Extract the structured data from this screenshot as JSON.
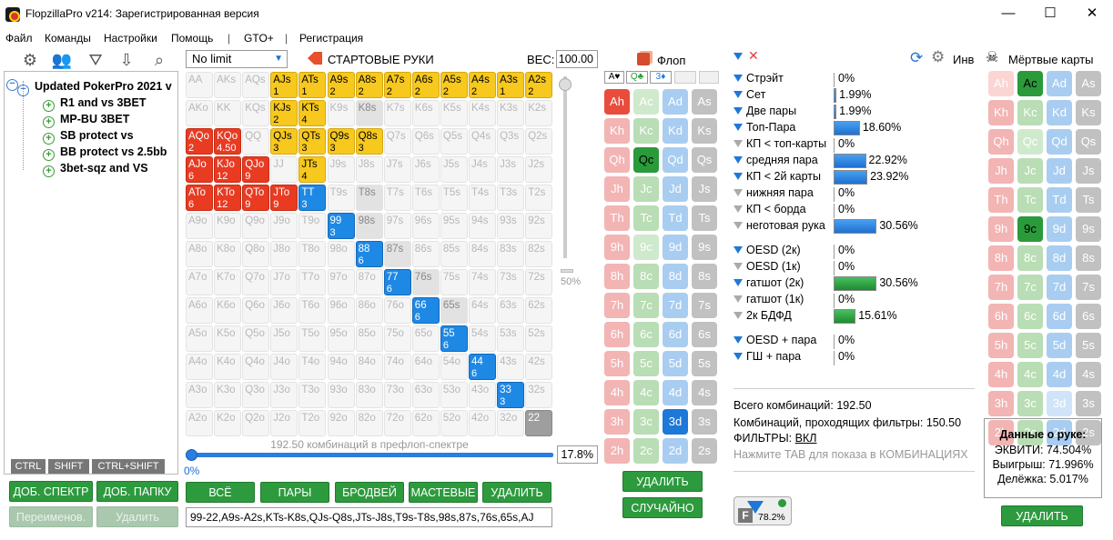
{
  "window": {
    "title": "FlopzillaPro v214: Зарегистрированная версия",
    "min": "—",
    "max": "☐",
    "close": "✕"
  },
  "menu": [
    "Файл",
    "Команды",
    "Настройки",
    "Помощь",
    "|",
    "GTO+",
    "|",
    "Регистрация"
  ],
  "tree": {
    "root": "Updated PokerPro 2021 v",
    "items": [
      "R1 and vs 3BET",
      "MP-BU 3BET",
      "SB protect vs",
      "BB protect vs 2.5bb",
      "3bet-sqz and VS"
    ]
  },
  "modkeys": [
    "CTRL",
    "SHIFT",
    "CTRL+SHIFT"
  ],
  "left_buttons": {
    "add_range": "ДОБ. СПЕКТР",
    "add_folder": "ДОБ. ПАПКУ",
    "rename": "Переименов.",
    "delete": "Удалить"
  },
  "range": {
    "limit": "No limit",
    "section": "СТАРТОВЫЕ РУКИ",
    "weight_label": "ВЕС:",
    "weight": "100.00",
    "slider_pct": "50%",
    "progress_text": "192.50 комбинаций в префлоп-спектре",
    "progress_start": "0%",
    "progress_pct": "17.8%",
    "progress_value": 0.178,
    "buttons": [
      "ВСЁ",
      "ПАРЫ",
      "БРОДВЕЙ",
      "МАСТЕВЫЕ",
      "УДАЛИТЬ"
    ],
    "text": "99-22,A9s-A2s,KTs-K8s,QJs-Q8s,JTs-J8s,T9s-T8s,98s,87s,76s,65s,AJ"
  },
  "grid_rows": [
    [
      "AA",
      "AKs",
      "AQs",
      "AJs|1",
      "ATs|1",
      "A9s|2",
      "A8s|2",
      "A7s|2",
      "A6s|2",
      "A5s|2",
      "A4s|2",
      "A3s|1",
      "A2s|2"
    ],
    [
      "AKo",
      "KK",
      "KQs",
      "KJs|2",
      "KTs|4",
      "K9s",
      "K8s",
      "K7s",
      "K6s",
      "K5s",
      "K4s",
      "K3s",
      "K2s"
    ],
    [
      "AQo|2",
      "KQo|4.50",
      "QQ",
      "QJs|3",
      "QTs|3",
      "Q9s|3",
      "Q8s|3",
      "Q7s",
      "Q6s",
      "Q5s",
      "Q4s",
      "Q3s",
      "Q2s"
    ],
    [
      "AJo|6",
      "KJo|12",
      "QJo|9",
      "JJ",
      "JTs|4",
      "J9s",
      "J8s",
      "J7s",
      "J6s",
      "J5s",
      "J4s",
      "J3s",
      "J2s"
    ],
    [
      "ATo|6",
      "KTo|12",
      "QTo|9",
      "JTo|9",
      "TT|3",
      "T9s",
      "T8s",
      "T7s",
      "T6s",
      "T5s",
      "T4s",
      "T3s",
      "T2s"
    ],
    [
      "A9o",
      "K9o",
      "Q9o",
      "J9o",
      "T9o",
      "99|3",
      "98s",
      "97s",
      "96s",
      "95s",
      "94s",
      "93s",
      "92s"
    ],
    [
      "A8o",
      "K8o",
      "Q8o",
      "J8o",
      "T8o",
      "98o",
      "88|6",
      "87s",
      "86s",
      "85s",
      "84s",
      "83s",
      "82s"
    ],
    [
      "A7o",
      "K7o",
      "Q7o",
      "J7o",
      "T7o",
      "97o",
      "87o",
      "77|6",
      "76s",
      "75s",
      "74s",
      "73s",
      "72s"
    ],
    [
      "A6o",
      "K6o",
      "Q6o",
      "J6o",
      "T6o",
      "96o",
      "86o",
      "76o",
      "66|6",
      "65s",
      "64s",
      "63s",
      "62s"
    ],
    [
      "A5o",
      "K5o",
      "Q5o",
      "J5o",
      "T5o",
      "95o",
      "85o",
      "75o",
      "65o",
      "55|6",
      "54s",
      "53s",
      "52s"
    ],
    [
      "A4o",
      "K4o",
      "Q4o",
      "J4o",
      "T4o",
      "94o",
      "84o",
      "74o",
      "64o",
      "54o",
      "44|6",
      "43s",
      "42s"
    ],
    [
      "A3o",
      "K3o",
      "Q3o",
      "J3o",
      "T3o",
      "93o",
      "83o",
      "73o",
      "63o",
      "53o",
      "43o",
      "33|3",
      "32s"
    ],
    [
      "A2o",
      "K2o",
      "Q2o",
      "J2o",
      "T2o",
      "92o",
      "82o",
      "72o",
      "62o",
      "52o",
      "42o",
      "32o",
      "22"
    ]
  ],
  "flop": {
    "title": "Флоп",
    "delete": "УДАЛИТЬ",
    "random": "СЛУЧАЙНО",
    "slots": [
      "A♥",
      "Q♣",
      "3♦",
      "",
      ""
    ]
  },
  "ranks": [
    "A",
    "K",
    "Q",
    "J",
    "T",
    "9",
    "8",
    "7",
    "6",
    "5",
    "4",
    "3",
    "2"
  ],
  "flop_selected": [
    "Ah",
    "Qc",
    "3d"
  ],
  "dead": {
    "title": "Мёртвые карты",
    "selected": [
      "Ac",
      "9c"
    ],
    "delete": "УДАЛИТЬ"
  },
  "inv_label": "Инв",
  "filters": [
    {
      "name": "Стрэйт",
      "pct": "0%",
      "val": 0,
      "on": true
    },
    {
      "name": "Сет",
      "pct": "1.99%",
      "val": 1.99,
      "on": true
    },
    {
      "name": "Две пары",
      "pct": "1.99%",
      "val": 1.99,
      "on": true
    },
    {
      "name": "Топ-Пара",
      "pct": "18.60%",
      "val": 18.6,
      "on": true
    },
    {
      "name": "КП < топ-карты",
      "pct": "0%",
      "val": 0,
      "on": false
    },
    {
      "name": "средняя пара",
      "pct": "22.92%",
      "val": 22.92,
      "on": true
    },
    {
      "name": "КП < 2й карты",
      "pct": "23.92%",
      "val": 23.92,
      "on": true
    },
    {
      "name": "нижняя пара",
      "pct": "0%",
      "val": 0,
      "on": false
    },
    {
      "name": "КП < борда",
      "pct": "0%",
      "val": 0,
      "on": false
    },
    {
      "name": "неготовая рука",
      "pct": "30.56%",
      "val": 30.56,
      "on": false
    },
    {
      "name": "OESD (2к)",
      "pct": "0%",
      "val": 0,
      "on": true
    },
    {
      "name": "OESD (1к)",
      "pct": "0%",
      "val": 0,
      "on": false
    },
    {
      "name": "гатшот (2к)",
      "pct": "30.56%",
      "val": 30.56,
      "on": true,
      "green": true
    },
    {
      "name": "гатшот (1к)",
      "pct": "0%",
      "val": 0,
      "on": false
    },
    {
      "name": "2к БДФД",
      "pct": "15.61%",
      "val": 15.61,
      "on": false,
      "green": true
    },
    {
      "name": "OESD + пара",
      "pct": "0%",
      "val": 0,
      "on": true
    },
    {
      "name": "ГШ + пара",
      "pct": "0%",
      "val": 0,
      "on": true
    }
  ],
  "stats": {
    "total": "Всего комбинаций: 192.50",
    "passing": "Комбинаций, проходящих фильтры: 150.50",
    "filters_label": "ФИЛЬТРЫ:",
    "filters_value": "ВКЛ",
    "hint": "Нажмите TAB для показа в КОМБИНАЦИЯХ",
    "badge": "78.2%"
  },
  "hand": {
    "title": "Данные о руке:",
    "equity": "ЭКВИТИ: 74.504%",
    "win": "Выигрыш: 71.996%",
    "tie": "Делёжка: 5.017%"
  },
  "colors": {
    "accent_green": "#2d9a3e",
    "accent_blue": "#1e78d8",
    "yellow": "#f7c81d",
    "red": "#e83b22"
  }
}
